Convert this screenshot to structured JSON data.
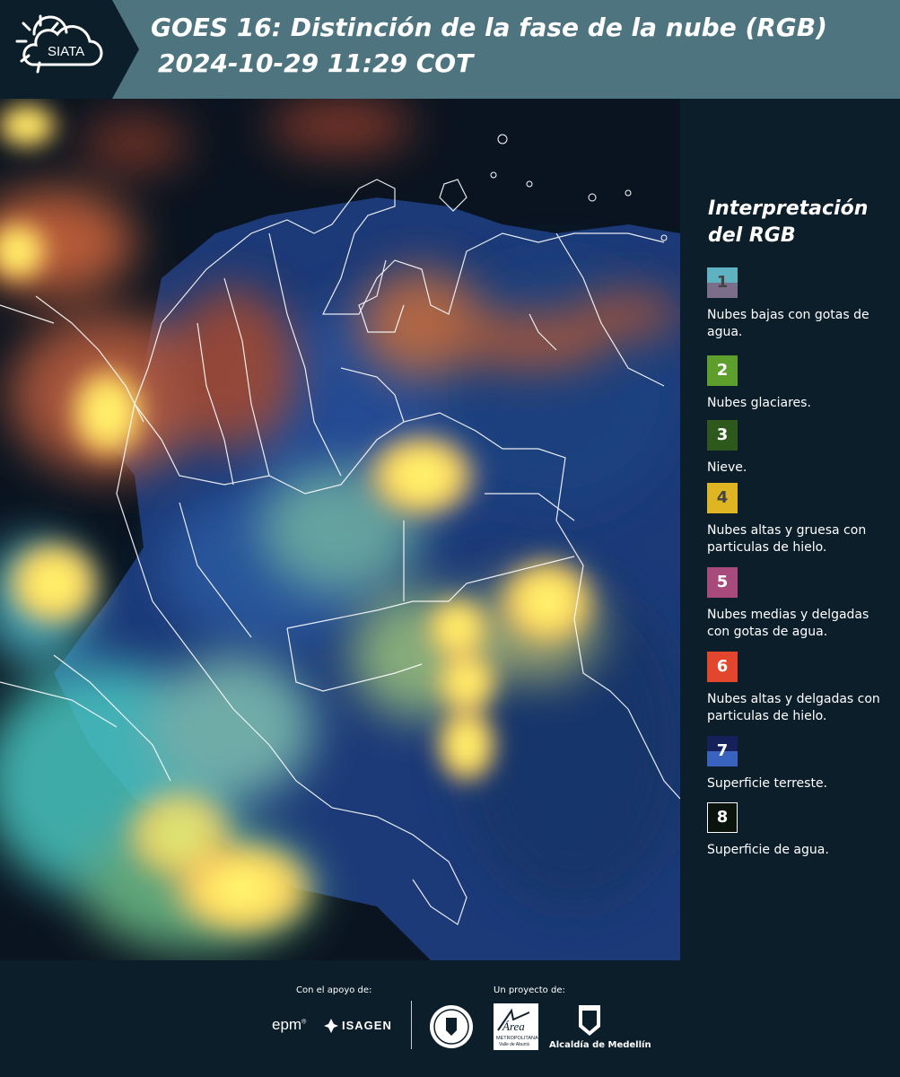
{
  "header": {
    "logo_text": "SIATA",
    "title_line1": "GOES 16: Distinción de la fase de la nube (RGB)",
    "title_line2": "2024-10-29 11:29 COT"
  },
  "legend": {
    "title_line1": "Interpretación",
    "title_line2": "del RGB",
    "items": [
      {
        "number": "1",
        "label": "Nubes bajas con gotas de agua.",
        "color_top": "#5fb3c0",
        "color_bottom": "#7a6e8a",
        "text_color": "#444444"
      },
      {
        "number": "2",
        "label": "Nubes glaciares.",
        "color_top": "#5e9e2c",
        "color_bottom": "#5e9e2c",
        "text_color": "#ffffff"
      },
      {
        "number": "3",
        "label": "Nieve.",
        "color_top": "#2d5a1c",
        "color_bottom": "#2d5a1c",
        "text_color": "#ffffff"
      },
      {
        "number": "4",
        "label": "Nubes altas y gruesa con particulas de hielo.",
        "color_top": "#e0b524",
        "color_bottom": "#e0b524",
        "text_color": "#444444"
      },
      {
        "number": "5",
        "label": "Nubes medias y delgadas con gotas de agua.",
        "color_top": "#a84a7c",
        "color_bottom": "#a84a7c",
        "text_color": "#ffffff"
      },
      {
        "number": "6",
        "label": "Nubes altas y delgadas con particulas de hielo.",
        "color_top": "#e2462c",
        "color_bottom": "#e2462c",
        "text_color": "#ffffff"
      },
      {
        "number": "7",
        "label": "Superficie terreste.",
        "color_top": "#16205a",
        "color_bottom": "#3a63c0",
        "text_color": "#ffffff"
      },
      {
        "number": "8",
        "label": "Superficie de agua.",
        "color_top": "#0a140c",
        "color_bottom": "#0a140c",
        "text_color": "#ffffff"
      }
    ]
  },
  "footer": {
    "support_label": "Con el apoyo de:",
    "project_label": "Un proyecto de:",
    "epm": "epm",
    "isagen": "ISAGEN",
    "area_text": "Área",
    "area_sub1": "METROPOLITANA",
    "area_sub2": "Valle de Aburrá",
    "alcaldia": "Alcaldía de Medellín"
  },
  "colors": {
    "header_bg": "#4e7480",
    "page_bg": "#0d1e2b",
    "logo_bg": "#0d1e2b"
  }
}
